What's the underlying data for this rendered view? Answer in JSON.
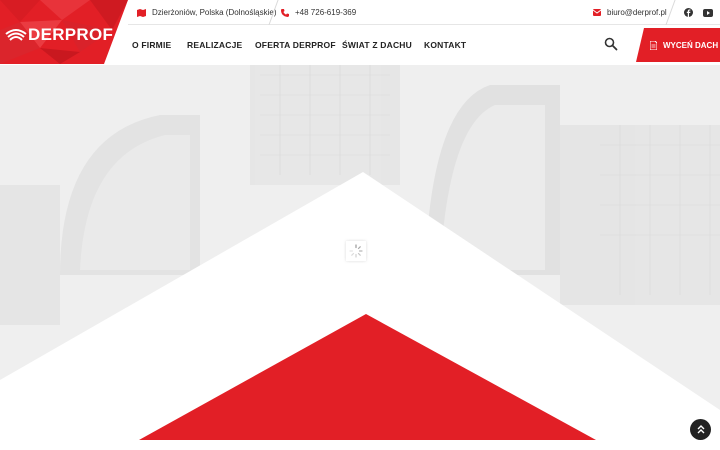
{
  "brand": {
    "name": "DERPROF",
    "color": "#e21f26"
  },
  "topbar": {
    "location": {
      "icon": "map-icon",
      "text": "Dzierżoniów, Polska (Dolnośląskie)"
    },
    "phone": {
      "icon": "phone-icon",
      "text": "+48 726-619-369"
    },
    "email": {
      "icon": "envelope-icon",
      "text": "biuro@derprof.pl"
    },
    "social": [
      "facebook-icon",
      "youtube-icon"
    ]
  },
  "nav": {
    "items": [
      {
        "label": "O FIRMIE"
      },
      {
        "label": "REALIZACJE"
      },
      {
        "label": "OFERTA DERPROF"
      },
      {
        "label": "ŚWIAT Z DACHU"
      },
      {
        "label": "KONTAKT"
      }
    ],
    "search_icon": "search-icon",
    "cta": {
      "label": "WYCEŃ DACH",
      "icon": "document-icon"
    }
  },
  "hero": {
    "loader_icon": "spinner-icon"
  },
  "scroll_top": {
    "icon": "double-chevron-up-icon"
  }
}
